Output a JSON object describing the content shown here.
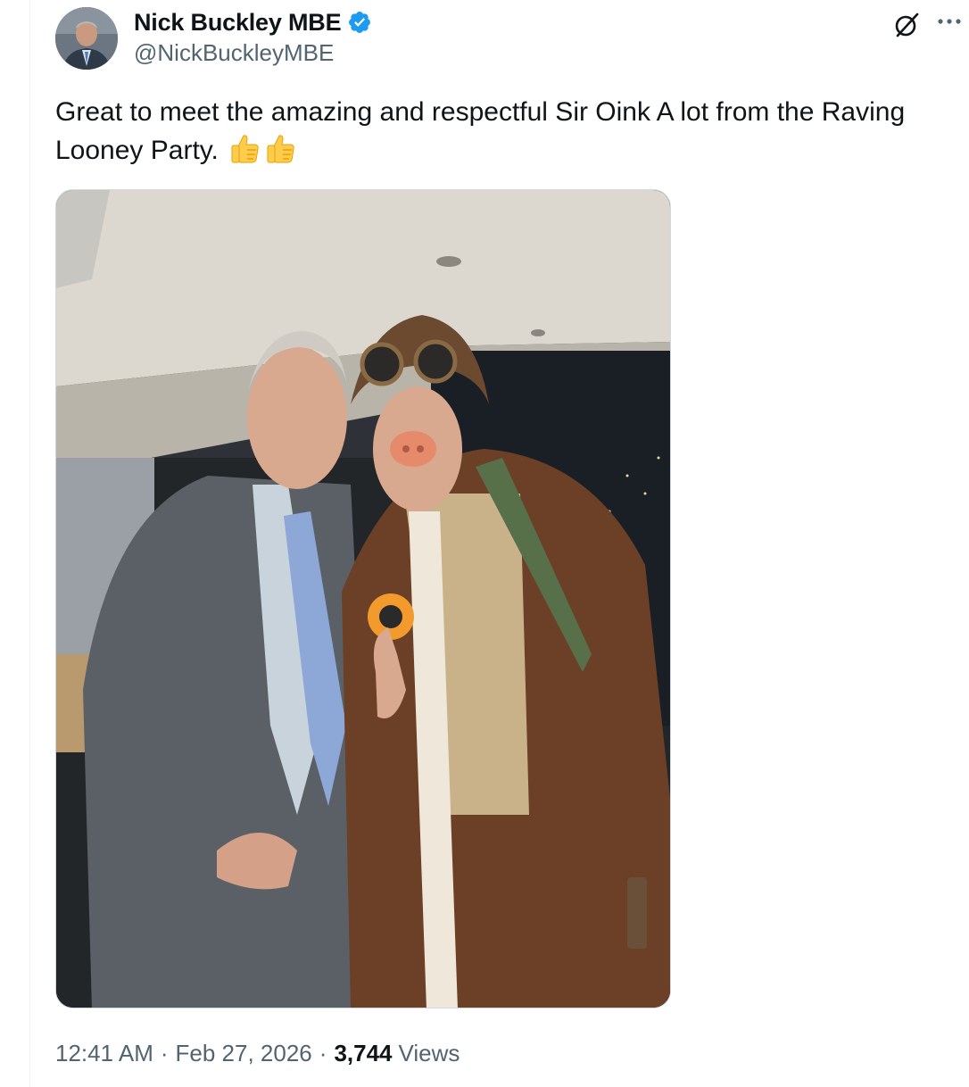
{
  "author": {
    "display_name": "Nick Buckley MBE",
    "handle": "@NickBuckleyMBE",
    "verified": true,
    "avatar_icon": "profile-photo",
    "verified_icon": "verified-badge-icon"
  },
  "tweet": {
    "text": "Great to meet the amazing and respectful Sir Oink A lot from the Raving Looney Party.",
    "emoji": [
      "thumbs-up",
      "thumbs-up"
    ],
    "media_description_icon": "photo"
  },
  "meta": {
    "time": "12:41 AM",
    "separator": "·",
    "date": "Feb 27, 2026",
    "views_count": "3,744",
    "views_label": "Views"
  },
  "actions": {
    "grok_icon": "grok-icon",
    "more_icon": "more-icon"
  },
  "colors": {
    "text_primary": "#0f1419",
    "text_secondary": "#536471",
    "verified_blue": "#1d9bf0",
    "border": "#cfd9de"
  }
}
